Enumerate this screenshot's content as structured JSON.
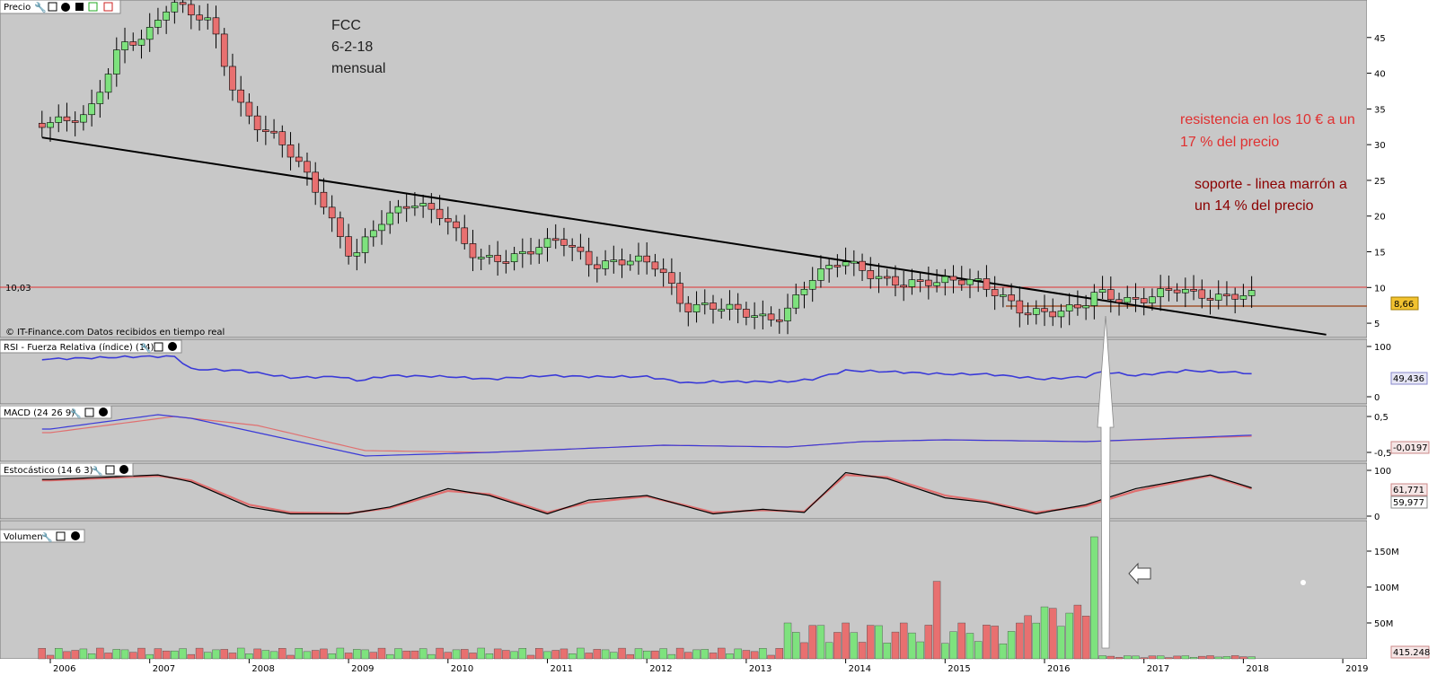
{
  "colors": {
    "panel_bg": "#c8c8c8",
    "bull": "#7ee27e",
    "bear": "#e87070",
    "trendline": "#000000",
    "resistance": "#e03030",
    "support": "#a0522d",
    "rsi": "#3a3ad8",
    "macd_line": "#3a3ad8",
    "macd_signal": "#e07070",
    "stoch_k": "#000000",
    "stoch_d": "#e07070",
    "ann_red": "#e03030",
    "ann_dark": "#8b0000"
  },
  "panels": {
    "price": {
      "title": "Precio",
      "credit": "© IT-Finance.com  Datos recibidos en tiempo real",
      "ref_value": "10,03",
      "last_value": "8,66",
      "ticks": [
        "5",
        "10",
        "15",
        "20",
        "25",
        "30",
        "35",
        "40",
        "45"
      ]
    },
    "rsi": {
      "title": "RSI - Fuerza Relativa (índice) (14)",
      "last_value": "49,436",
      "ticks": [
        "0",
        "100"
      ]
    },
    "macd": {
      "title": "MACD (24 26 9)",
      "last_value": "-0,0197",
      "ticks": [
        "0,5",
        "-0,5"
      ]
    },
    "stoch": {
      "title": "Estocástico (14 6 3)",
      "last_value_k": "61,771",
      "last_value_d": "59,977",
      "ticks": [
        "0",
        "100"
      ]
    },
    "volume": {
      "title": "Volumen",
      "last_value": "415.248",
      "ticks": [
        "50M",
        "100M",
        "150M"
      ]
    }
  },
  "annotations": {
    "title": "FCC",
    "date": "6-2-18",
    "period": "mensual",
    "resistance_line1": "resistencia  en los  10 € a un",
    "resistance_line2": "17 % del precio",
    "support_line1": "soporte - linea marrón a",
    "support_line2": "un 14 % del precio"
  },
  "chart_data": {
    "type": "candlestick",
    "title": "FCC",
    "interval": "mensual",
    "x_axis_years": [
      "2006",
      "2007",
      "2008",
      "2009",
      "2010",
      "2011",
      "2012",
      "2013",
      "2014",
      "2015",
      "2016",
      "2017",
      "2018",
      "2019"
    ],
    "price_ylim": [
      3,
      50
    ],
    "price_levels": {
      "resistance": 10.03,
      "support": 7.4,
      "last": 8.66
    },
    "trendline": {
      "from": {
        "date": "2005-12",
        "price": 31
      },
      "to": {
        "date": "2018-11",
        "price": 3.4
      }
    },
    "price_anchors": [
      [
        "2006-01",
        33
      ],
      [
        "2006-06",
        34
      ],
      [
        "2006-10",
        44
      ],
      [
        "2007-01",
        45
      ],
      [
        "2007-04",
        50
      ],
      [
        "2007-09",
        47
      ],
      [
        "2007-12",
        36
      ],
      [
        "2008-03",
        32
      ],
      [
        "2008-05",
        31
      ],
      [
        "2008-09",
        25
      ],
      [
        "2008-12",
        18
      ],
      [
        "2009-02",
        14
      ],
      [
        "2009-05",
        19
      ],
      [
        "2009-09",
        22
      ],
      [
        "2010-01",
        20
      ],
      [
        "2010-05",
        14
      ],
      [
        "2010-09",
        14
      ],
      [
        "2011-03",
        17
      ],
      [
        "2011-07",
        13
      ],
      [
        "2011-12",
        14
      ],
      [
        "2012-03",
        13
      ],
      [
        "2012-06",
        7
      ],
      [
        "2012-09",
        7.5
      ],
      [
        "2012-12",
        7
      ],
      [
        "2013-04",
        5.5
      ],
      [
        "2013-06",
        6
      ],
      [
        "2013-09",
        11
      ],
      [
        "2014-01",
        14
      ],
      [
        "2014-05",
        11.5
      ],
      [
        "2014-08",
        10.5
      ],
      [
        "2015-02",
        11
      ],
      [
        "2015-05",
        11
      ],
      [
        "2015-08",
        9
      ],
      [
        "2015-11",
        6.5
      ],
      [
        "2016-03",
        6.5
      ],
      [
        "2016-06",
        7.5
      ],
      [
        "2016-08",
        9.5
      ],
      [
        "2016-11",
        8
      ],
      [
        "2017-02",
        8.5
      ],
      [
        "2017-05",
        10
      ],
      [
        "2017-08",
        9
      ],
      [
        "2017-10",
        8.5
      ],
      [
        "2018-01",
        9
      ]
    ],
    "rsi": {
      "ylim": [
        0,
        100
      ],
      "anchors": [
        [
          "2006-01",
          75
        ],
        [
          "2006-12",
          80
        ],
        [
          "2007-04",
          80
        ],
        [
          "2007-06",
          55
        ],
        [
          "2007-12",
          52
        ],
        [
          "2008-06",
          38
        ],
        [
          "2008-12",
          40
        ],
        [
          "2009-02",
          32
        ],
        [
          "2009-06",
          42
        ],
        [
          "2010-01",
          40
        ],
        [
          "2010-06",
          35
        ],
        [
          "2011-01",
          42
        ],
        [
          "2011-06",
          40
        ],
        [
          "2012-01",
          40
        ],
        [
          "2012-06",
          27
        ],
        [
          "2012-09",
          30
        ],
        [
          "2013-06",
          30
        ],
        [
          "2013-09",
          35
        ],
        [
          "2014-01",
          52
        ],
        [
          "2014-06",
          50
        ],
        [
          "2015-01",
          45
        ],
        [
          "2015-06",
          45
        ],
        [
          "2016-01",
          35
        ],
        [
          "2016-06",
          40
        ],
        [
          "2016-08",
          50
        ],
        [
          "2016-12",
          42
        ],
        [
          "2017-06",
          52
        ],
        [
          "2018-01",
          48
        ],
        [
          "2018-02",
          45
        ]
      ]
    },
    "macd": {
      "ylim": [
        -0.7,
        0.7
      ],
      "macd_anchors": [
        [
          "2006-01",
          0.15
        ],
        [
          "2007-02",
          0.55
        ],
        [
          "2007-06",
          0.45
        ],
        [
          "2008-03",
          0.0
        ],
        [
          "2009-03",
          -0.6
        ],
        [
          "2010-06",
          -0.5
        ],
        [
          "2012-03",
          -0.3
        ],
        [
          "2013-06",
          -0.35
        ],
        [
          "2014-03",
          -0.2
        ],
        [
          "2015-01",
          -0.15
        ],
        [
          "2016-06",
          -0.2
        ],
        [
          "2018-02",
          -0.0197
        ]
      ],
      "signal_anchors": [
        [
          "2006-01",
          0.05
        ],
        [
          "2007-04",
          0.5
        ],
        [
          "2008-02",
          0.25
        ],
        [
          "2009-03",
          -0.45
        ],
        [
          "2010-06",
          -0.5
        ],
        [
          "2012-03",
          -0.3
        ],
        [
          "2013-06",
          -0.35
        ],
        [
          "2014-03",
          -0.2
        ],
        [
          "2015-01",
          -0.15
        ],
        [
          "2016-06",
          -0.2
        ],
        [
          "2018-02",
          -0.05
        ]
      ]
    },
    "stoch": {
      "ylim": [
        0,
        100
      ],
      "k_anchors": [
        [
          "2006-01",
          80
        ],
        [
          "2007-02",
          90
        ],
        [
          "2007-06",
          75
        ],
        [
          "2008-01",
          20
        ],
        [
          "2008-06",
          5
        ],
        [
          "2009-01",
          5
        ],
        [
          "2009-06",
          20
        ],
        [
          "2010-01",
          60
        ],
        [
          "2010-06",
          45
        ],
        [
          "2011-01",
          5
        ],
        [
          "2011-06",
          35
        ],
        [
          "2012-01",
          45
        ],
        [
          "2012-06",
          20
        ],
        [
          "2012-09",
          5
        ],
        [
          "2013-03",
          15
        ],
        [
          "2013-08",
          8
        ],
        [
          "2014-01",
          95
        ],
        [
          "2014-06",
          82
        ],
        [
          "2015-01",
          40
        ],
        [
          "2015-06",
          30
        ],
        [
          "2015-12",
          5
        ],
        [
          "2016-06",
          25
        ],
        [
          "2016-12",
          60
        ],
        [
          "2017-06",
          80
        ],
        [
          "2017-09",
          90
        ],
        [
          "2018-02",
          61.771
        ]
      ],
      "d_anchors": [
        [
          "2006-01",
          78
        ],
        [
          "2007-02",
          88
        ],
        [
          "2007-06",
          78
        ],
        [
          "2008-01",
          25
        ],
        [
          "2008-06",
          8
        ],
        [
          "2009-01",
          6
        ],
        [
          "2009-06",
          18
        ],
        [
          "2010-01",
          55
        ],
        [
          "2010-06",
          48
        ],
        [
          "2011-01",
          8
        ],
        [
          "2011-06",
          30
        ],
        [
          "2012-01",
          43
        ],
        [
          "2012-06",
          22
        ],
        [
          "2012-09",
          8
        ],
        [
          "2013-03",
          13
        ],
        [
          "2013-08",
          10
        ],
        [
          "2014-01",
          90
        ],
        [
          "2014-06",
          85
        ],
        [
          "2015-01",
          45
        ],
        [
          "2015-06",
          32
        ],
        [
          "2015-12",
          8
        ],
        [
          "2016-06",
          22
        ],
        [
          "2016-12",
          55
        ],
        [
          "2017-06",
          78
        ],
        [
          "2017-09",
          88
        ],
        [
          "2018-02",
          59.977
        ]
      ]
    },
    "volume": {
      "ylim": [
        0,
        180
      ],
      "unit": "M",
      "spikes": [
        [
          "2014-12",
          108
        ],
        [
          "2016-07",
          170
        ]
      ],
      "last": "415.248"
    }
  }
}
